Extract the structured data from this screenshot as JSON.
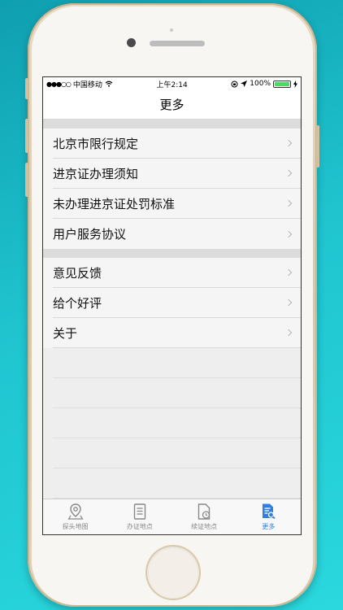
{
  "status_bar": {
    "signal": "●●●○○",
    "carrier": "中国移动",
    "wifi_icon": "wifi-icon",
    "time": "上午2:14",
    "battery": "100%",
    "battery_level": 1.0
  },
  "nav": {
    "title": "更多"
  },
  "sections": [
    {
      "items": [
        {
          "label": "北京市限行规定"
        },
        {
          "label": "进京证办理须知"
        },
        {
          "label": "未办理进京证处罚标准"
        },
        {
          "label": "用户服务协议"
        }
      ]
    },
    {
      "items": [
        {
          "label": "意见反馈"
        },
        {
          "label": "给个好评"
        },
        {
          "label": "关于"
        }
      ]
    }
  ],
  "tabs": [
    {
      "label": "探头地图",
      "icon": "map-pin-icon",
      "active": false
    },
    {
      "label": "办证地点",
      "icon": "document-icon",
      "active": false
    },
    {
      "label": "续证地点",
      "icon": "document-clock-icon",
      "active": false
    },
    {
      "label": "更多",
      "icon": "document-search-icon",
      "active": true
    }
  ],
  "colors": {
    "accent": "#2f7fe0",
    "battery": "#4cd964",
    "background": "#1fc4cf"
  }
}
